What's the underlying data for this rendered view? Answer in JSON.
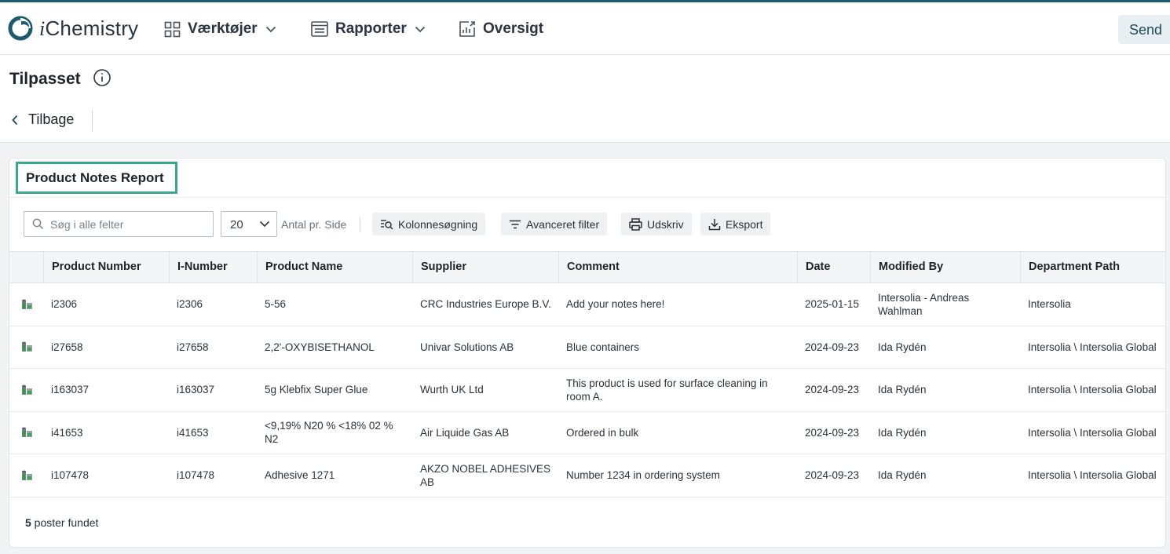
{
  "app": {
    "logo_initial": "i",
    "logo_rest": "Chemistry"
  },
  "nav": {
    "tools": "Værktøjer",
    "reports": "Rapporter",
    "overview": "Oversigt",
    "send": "Send"
  },
  "page": {
    "title": "Tilpasset",
    "back_label": "Tilbage"
  },
  "report": {
    "title": "Product Notes Report",
    "search_placeholder": "Søg i alle felter",
    "page_size": "20",
    "per_page_label": "Antal pr. Side",
    "buttons": {
      "column_search": "Kolonnesøgning",
      "advanced_filter": "Avanceret filter",
      "print": "Udskriv",
      "export": "Eksport"
    },
    "columns": [
      "Product Number",
      "I-Number",
      "Product Name",
      "Supplier",
      "Comment",
      "Date",
      "Modified By",
      "Department Path"
    ],
    "rows": [
      [
        "i2306",
        "i2306",
        "5-56",
        "CRC Industries Europe B.V.",
        "Add your notes here!",
        "2025-01-15",
        "Intersolia - Andreas Wahlman",
        "Intersolia"
      ],
      [
        "i27658",
        "i27658",
        "2,2'-OXYBISETHANOL",
        "Univar Solutions AB",
        "Blue containers",
        "2024-09-23",
        "Ida Rydén",
        "Intersolia \\ Intersolia Global"
      ],
      [
        "i163037",
        "i163037",
        "5g Klebfix Super Glue",
        "Wurth UK Ltd",
        "This product is used for surface cleaning in room A.",
        "2024-09-23",
        "Ida Rydén",
        "Intersolia \\ Intersolia Global"
      ],
      [
        "i41653",
        "i41653",
        "<9,19% N20 % <18% 02 % N2",
        "Air Liquide Gas AB",
        "Ordered in bulk",
        "2024-09-23",
        "Ida Rydén",
        "Intersolia \\ Intersolia Global"
      ],
      [
        "i107478",
        "i107478",
        "Adhesive 1271",
        "AKZO NOBEL ADHESIVES AB",
        "Number 1234 in ordering system",
        "2024-09-23",
        "Ida Rydén",
        "Intersolia \\ Intersolia Global"
      ]
    ],
    "footer_count": "5",
    "footer_label": " poster fundet"
  },
  "colors": {
    "accent": "#1d5a6e",
    "highlight_border": "#3aa891"
  }
}
